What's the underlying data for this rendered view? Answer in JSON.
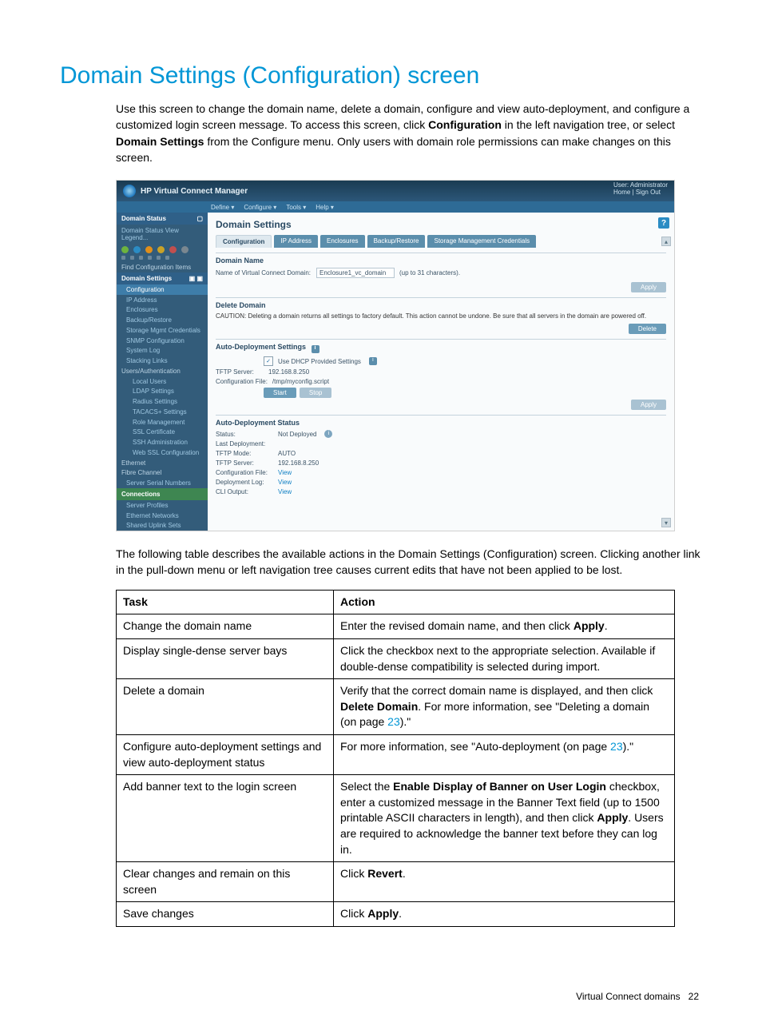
{
  "heading": "Domain Settings (Configuration) screen",
  "intro": {
    "p1a": "Use this screen to change the domain name, delete a domain, configure and view auto-deployment, and configure a customized login screen message. To access this screen, click ",
    "p1b": "Configuration",
    "p1c": " in the left navigation tree, or select ",
    "p1d": "Domain Settings",
    "p1e": " from the Configure menu. Only users with domain role permissions can make changes on this screen."
  },
  "screenshot": {
    "app_title": "HP Virtual Connect Manager",
    "user_label": "User:",
    "user_value": "Administrator",
    "home_link": "Home",
    "signout_link": "Sign Out",
    "menus": [
      "Define ▾",
      "Configure ▾",
      "Tools ▾",
      "Help ▾"
    ],
    "sidebar": {
      "status_header": "Domain Status",
      "status_links": "Domain Status    View Legend...",
      "find_label": "Find Configuration Items",
      "settings_header": "Domain Settings",
      "items": [
        "Configuration",
        "IP Address",
        "Enclosures",
        "Backup/Restore",
        "Storage Mgmt Credentials",
        "SNMP Configuration",
        "System Log",
        "Stacking Links"
      ],
      "group_users": "Users/Authentication",
      "users_items": [
        "Local Users",
        "LDAP Settings",
        "Radius Settings",
        "TACACS+ Settings",
        "Role Management",
        "SSL Certificate",
        "SSH Administration",
        "Web SSL Configuration"
      ],
      "group_eth": "Ethernet",
      "group_fc": "Fibre Channel",
      "item_serial": "Server Serial Numbers",
      "connections_header": "Connections",
      "conn_items": [
        "Server Profiles",
        "Ethernet Networks",
        "Shared Uplink Sets"
      ]
    },
    "main": {
      "title": "Domain Settings",
      "tabs": [
        "Configuration",
        "IP Address",
        "Enclosures",
        "Backup/Restore",
        "Storage Management Credentials"
      ],
      "domain_name_header": "Domain Name",
      "domain_name_label": "Name of Virtual Connect Domain:",
      "domain_name_value": "Enclosure1_vc_domain",
      "domain_name_hint": "(up to 31 characters).",
      "apply_btn": "Apply",
      "delete_header": "Delete Domain",
      "caution_text": "CAUTION:  Deleting a domain returns all settings to factory default. This action cannot be undone. Be sure that all servers in the domain are powered off.",
      "delete_btn": "Delete",
      "autodep_header": "Auto-Deployment Settings",
      "use_dhcp": "Use DHCP Provided Settings",
      "tftp_server_lbl": "TFTP Server:",
      "tftp_server_val": "192.168.8.250",
      "config_file_lbl": "Configuration File:",
      "config_file_val": "/tmp/myconfig.script",
      "start_btn": "Start",
      "stop_btn": "Stop",
      "autostatus_header": "Auto-Deployment Status",
      "status_lbl": "Status:",
      "status_val": "Not Deployed",
      "last_dep_lbl": "Last Deployment:",
      "tftp_mode_lbl": "TFTP Mode:",
      "tftp_mode_val": "AUTO",
      "tftp_server2_lbl": "TFTP Server:",
      "tftp_server2_val": "192.168.8.250",
      "config_file2_lbl": "Configuration File:",
      "deplog_lbl": "Deployment Log:",
      "cli_lbl": "CLI Output:",
      "view_link": "View"
    }
  },
  "between": "The following table describes the available actions in the Domain Settings (Configuration) screen. Clicking another link in the pull-down menu or left navigation tree causes current edits that have not been applied to be lost.",
  "table": {
    "headers": [
      "Task",
      "Action"
    ],
    "rows": [
      {
        "task": "Change the domain name",
        "action_a": "Enter the revised domain name, and then click ",
        "action_b": "Apply",
        "action_c": "."
      },
      {
        "task": "Display single-dense server bays",
        "action_a": "Click the checkbox next to the appropriate selection. Available if double-dense compatibility is selected during import."
      },
      {
        "task": "Delete a domain",
        "action_a": "Verify that the correct domain name is displayed, and then click ",
        "action_b": "Delete Domain",
        "action_c": ". For more information, see \"Deleting a domain (on page ",
        "action_page": "23",
        "action_d": ").\""
      },
      {
        "task": "Configure auto-deployment settings and view auto-deployment status",
        "action_a": "For more information, see \"Auto-deployment (on page ",
        "action_page": "23",
        "action_d": ").\""
      },
      {
        "task": "Add banner text to the login screen",
        "action_a": "Select the ",
        "action_b": "Enable Display of Banner on User Login",
        "action_c": " checkbox, enter a customized message in the Banner Text field (up to 1500 printable ASCII characters in length), and then click ",
        "action_b2": "Apply",
        "action_d": ". Users are required to acknowledge the banner text before they can log in."
      },
      {
        "task": "Clear changes and remain on this screen",
        "action_a": "Click ",
        "action_b": "Revert",
        "action_c": "."
      },
      {
        "task": "Save changes",
        "action_a": "Click ",
        "action_b": "Apply",
        "action_c": "."
      }
    ]
  },
  "footer": {
    "section": "Virtual Connect domains",
    "page": "22"
  }
}
